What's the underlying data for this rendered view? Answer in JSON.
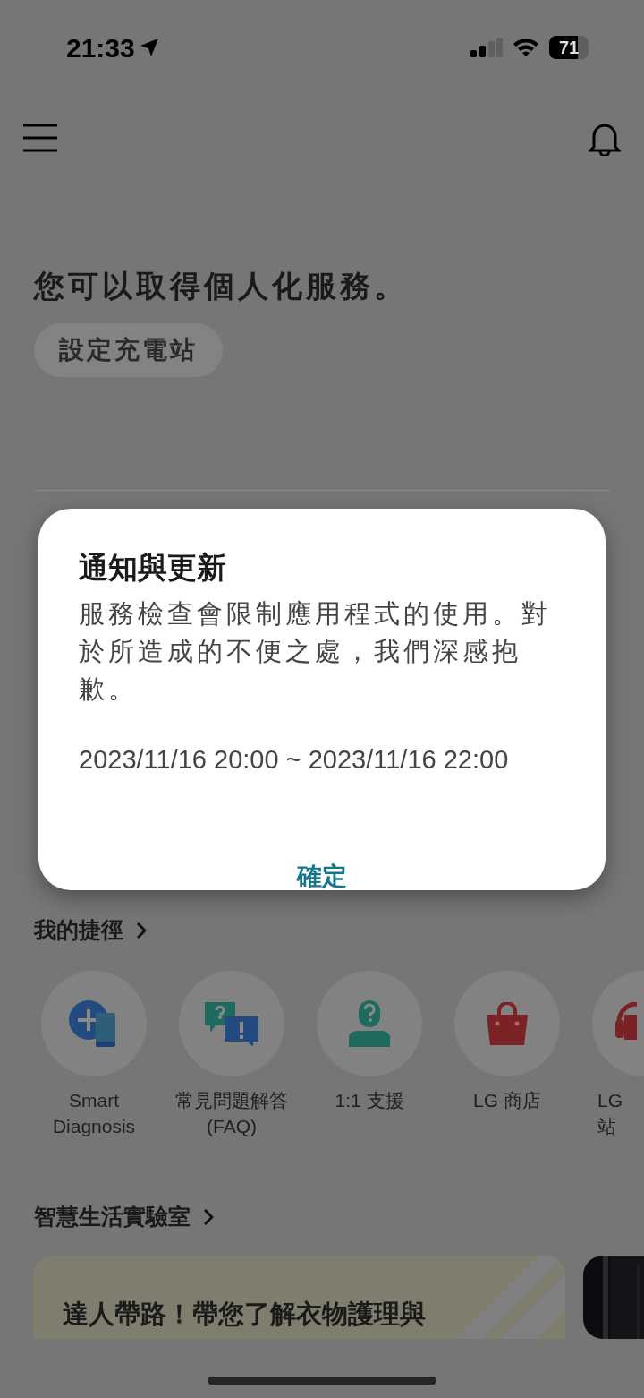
{
  "status_bar": {
    "time": "21:33",
    "battery": "71"
  },
  "heading": "您可以取得個人化服務。",
  "chip": "設定充電站",
  "dialog": {
    "title": "通知與更新",
    "message": "服務檢查會限制應用程式的使用。對於所造成的不便之處，我們深感抱歉。",
    "period": "2023/11/16 20:00 ~ 2023/11/16 22:00",
    "button": "確定"
  },
  "shortcuts": {
    "title": "我的捷徑",
    "items": [
      {
        "kind": "diagnosis",
        "lines": [
          "Smart",
          "Diagnosis"
        ]
      },
      {
        "kind": "faq",
        "lines": [
          "常見問題解答",
          "(FAQ)"
        ]
      },
      {
        "kind": "support",
        "lines": [
          "1:1 支援"
        ]
      },
      {
        "kind": "store",
        "lines": [
          "LG 商店"
        ]
      },
      {
        "kind": "headset",
        "lines": [
          "LG",
          "站"
        ]
      }
    ]
  },
  "lab": {
    "title": "智慧生活實驗室",
    "cards": [
      {
        "kind": "article",
        "title": "達人帶路！帶您了解衣物護理與"
      },
      {
        "kind": "picture"
      }
    ]
  }
}
